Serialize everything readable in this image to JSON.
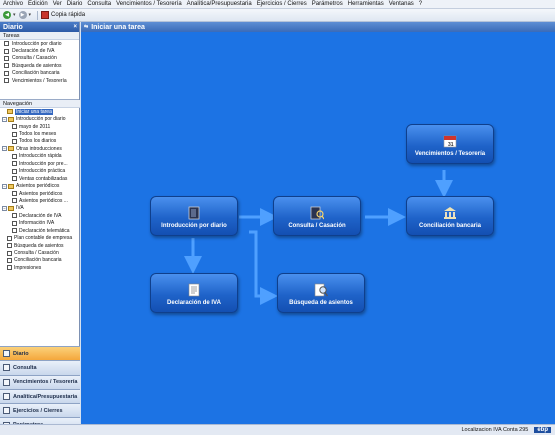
{
  "menu": [
    "Archivo",
    "Edición",
    "Ver",
    "Diario",
    "Consulta",
    "Vencimientos / Tesorería",
    "Analítica/Presupuestaria",
    "Ejercicios / Cierres",
    "Parámetros",
    "Herramientas",
    "Ventanas",
    "?"
  ],
  "toolbar": {
    "quick_copy": "Copia rápida"
  },
  "left_panel": {
    "title": "Diario",
    "close": "×",
    "tasks_header": "Tareas",
    "nav_header": "Navegación"
  },
  "tasks": [
    "Introducción por diario",
    "Declaración de IVA",
    "Consulta / Casación",
    "Búsqueda de asientos",
    "Conciliación bancaria",
    "Vencimientos / Tesorería"
  ],
  "tree": [
    {
      "label": "Iniciar una tarea",
      "level": 1,
      "kind": "folder",
      "selected": true
    },
    {
      "label": "Introducción por diario",
      "level": 0,
      "kind": "expander"
    },
    {
      "label": "mayo de 2011",
      "level": 2,
      "kind": "doc"
    },
    {
      "label": "Todos los meses",
      "level": 2,
      "kind": "doc"
    },
    {
      "label": "Todos los diarios",
      "level": 2,
      "kind": "doc"
    },
    {
      "label": "Otras introducciones",
      "level": 0,
      "kind": "expander"
    },
    {
      "label": "Introducción rápida",
      "level": 2,
      "kind": "doc"
    },
    {
      "label": "Introducción por pre...",
      "level": 2,
      "kind": "doc"
    },
    {
      "label": "Introducción práctica",
      "level": 2,
      "kind": "doc"
    },
    {
      "label": "Ventas contabilizadas",
      "level": 2,
      "kind": "doc"
    },
    {
      "label": "Asientos periódicos",
      "level": 0,
      "kind": "expander"
    },
    {
      "label": "Asientos periódicos",
      "level": 2,
      "kind": "doc"
    },
    {
      "label": "Asientos periódicos ...",
      "level": 2,
      "kind": "doc"
    },
    {
      "label": "IVA",
      "level": 0,
      "kind": "expander"
    },
    {
      "label": "Declaración de IVA",
      "level": 2,
      "kind": "doc"
    },
    {
      "label": "Información IVA",
      "level": 2,
      "kind": "doc"
    },
    {
      "label": "Declaración telemática",
      "level": 2,
      "kind": "doc"
    },
    {
      "label": "Plan contable de empresa",
      "level": 1,
      "kind": "doc"
    },
    {
      "label": "Búsqueda de asientos",
      "level": 1,
      "kind": "doc"
    },
    {
      "label": "Consulta / Casación",
      "level": 1,
      "kind": "doc"
    },
    {
      "label": "Conciliación bancaria",
      "level": 1,
      "kind": "doc"
    },
    {
      "label": "Impresiones",
      "level": 1,
      "kind": "doc"
    }
  ],
  "bottom_nav": [
    {
      "label": "Diario",
      "active": true
    },
    {
      "label": "Consulta",
      "active": false
    },
    {
      "label": "Vencimientos / Tesorería",
      "active": false
    },
    {
      "label": "Analítica/Presupuestaria",
      "active": false
    },
    {
      "label": "Ejercicios / Cierres",
      "active": false
    },
    {
      "label": "Parámetros",
      "active": false
    }
  ],
  "main": {
    "title": "Iniciar una tarea",
    "cards": {
      "introduccion": "Introducción por diario",
      "consulta": "Consulta / Casación",
      "conciliacion": "Conciliación bancaria",
      "vencimientos": "Vencimientos / Tesorería",
      "declaracion": "Declaración de IVA",
      "busqueda": "Búsqueda de asientos"
    }
  },
  "status": {
    "text": "Localizacion IVA Conta 295",
    "logo": "ebp"
  },
  "colors": {
    "main_bg": "#1c73e4",
    "card": "#1f63c9",
    "arrow": "#4fa0ff",
    "active_nav": "#f4a73c"
  }
}
